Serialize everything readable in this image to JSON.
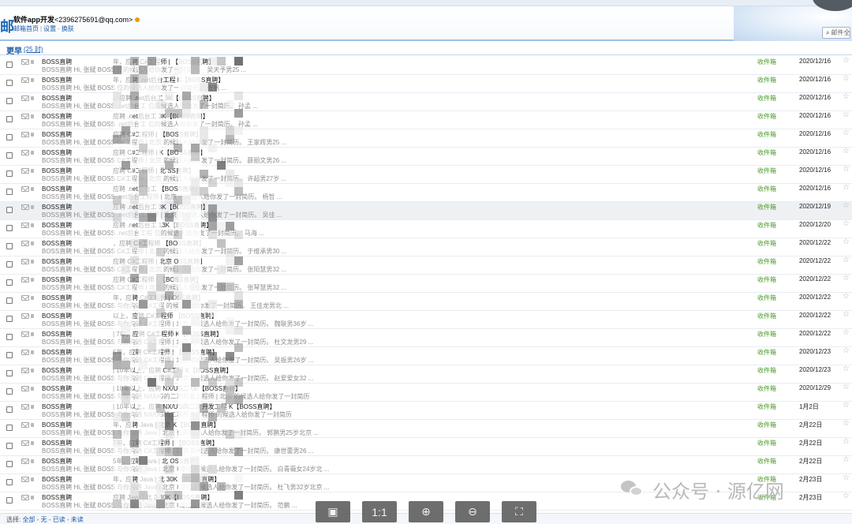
{
  "header": {
    "account_name": "软件app开发",
    "account_email": "<2396275691@qq.com>",
    "links": [
      "邮箱首页",
      "设置",
      "换肤"
    ],
    "search_placeholder": "邮件全"
  },
  "section": {
    "title": "更早",
    "count": "(25 封)"
  },
  "rows": [
    {
      "sender": "BOSS直聘",
      "subject": "年，应聘 C#工程师 | 【BOSS直聘】",
      "preview": "BOSS直聘 Hi, 张斌 BOSS 位的候选人给你发了一封简历。 吴天予男25 ...",
      "folder": "收件箱",
      "date": "2020/12/16"
    },
    {
      "sender": "BOSS直聘",
      "subject": "年，应聘 .net后台工程 K【BOSS直聘】",
      "preview": "BOSS直聘 Hi, 张斌 BOSS 位的候选人给你发了一封简历。 张帆 ...",
      "folder": "收件箱",
      "date": "2020/12/16"
    },
    {
      "sender": "BOSS直聘",
      "subject": "，应聘 .net后台工 3K【BOSS直聘】",
      "preview": "BOSS直聘 Hi, 张斌 BOSS .net后台工 位的候选人给你发了一封简历。 孙孟 ...",
      "folder": "收件箱",
      "date": "2020/12/16"
    },
    {
      "sender": "BOSS直聘",
      "subject": "应聘 .net后台工 3K【BOSS直聘】",
      "preview": "BOSS直聘 Hi, 张斌 BOSS .net后台工 位的候选人给你发了一封简历。 孙孟 ...",
      "folder": "收件箱",
      "date": "2020/12/16"
    },
    {
      "sender": "BOSS直聘",
      "subject": "应聘 C#工程师 | 【BOSS直聘】",
      "preview": "BOSS直聘 Hi, 张斌 BOSS C#工程师 | 北京 的候选人给你发了一封简历。 王家辉男25 ...",
      "folder": "收件箱",
      "date": "2020/12/16"
    },
    {
      "sender": "BOSS直聘",
      "subject": "应聘 C#工程师 | K【BOSS直聘】",
      "preview": "BOSS直聘 Hi, 张斌 BOSS C#工程师 | 北京 的候选人给你发了一封简历。 薛丽文男26 ...",
      "folder": "收件箱",
      "date": "2020/12/16"
    },
    {
      "sender": "BOSS直聘",
      "subject": "应聘 C#工程师 | 北 SS直聘】",
      "preview": "BOSS直聘 Hi, 张斌 BOSS C#工程师 | 北京 的候选人给你发了一封简历。 许超男27岁 ...",
      "folder": "收件箱",
      "date": "2020/12/16"
    },
    {
      "sender": "BOSS直聘",
      "subject": "应聘 .net后台工 【BOSS直聘】",
      "preview": "BOSS直聘 Hi, 张斌 BOSS .net后台工程师 | 北京 的候选人给你发了一封简历。 杨哲 ...",
      "folder": "收件箱",
      "date": "2020/12/16"
    },
    {
      "sender": "BOSS直聘",
      "subject": "应聘 .net后台工 3K【BOSS直聘】",
      "preview": "BOSS直聘 Hi, 张斌 BOSS .net后台工程师 | 北京 的候选人给你发了一封简历。 吴佳 ...",
      "folder": "收件箱",
      "date": "2020/12/19"
    },
    {
      "sender": "BOSS直聘",
      "subject": "应聘 .net后台工 13K【BOSS直聘】",
      "preview": "BOSS直聘 Hi, 张斌 BOSS .net后台工程 位的候选人给你发了一封简历。 马海 ...",
      "folder": "收件箱",
      "date": "2020/12/20"
    },
    {
      "sender": "BOSS直聘",
      "subject": "，应聘 C#工程师 【BOSS直聘】",
      "preview": "BOSS直聘 Hi, 张斌 BOSS C#工程师 | 北京 的候选人给你发了一封简历。 于维承男30 ...",
      "folder": "收件箱",
      "date": "2020/12/22"
    },
    {
      "sender": "BOSS直聘",
      "subject": "应聘 C#工程师 | 北京 OSS直聘】",
      "preview": "BOSS直聘 Hi, 张斌 BOSS C#工程师 | 北京 的候选人给你发了一封简历。 张阳慧男32 ...",
      "folder": "收件箱",
      "date": "2020/12/22"
    },
    {
      "sender": "BOSS直聘",
      "subject": "应聘 C#工程师 | 【BOSS直聘】",
      "preview": "BOSS直聘 Hi, 张斌 BOSS C#工程师 | 北京 的候选人给你发了一封简历。 张琴慧男32 ...",
      "folder": "收件箱",
      "date": "2020/12/22"
    },
    {
      "sender": "BOSS直聘",
      "subject": "年，应聘 C#工程师 | OSS直聘】",
      "preview": "BOSS直聘 Hi, 张斌 BOSS 与你沟通 C#工程 的候选人给你发了一封简历。 王佳龙男北 ...",
      "folder": "收件箱",
      "date": "2020/12/22"
    },
    {
      "sender": "BOSS直聘",
      "subject": "以上，应聘 C#工程师 【BOSS直聘】",
      "preview": "BOSS直聘 Hi, 张斌 BOSS 与你沟通 C#工程师 | 北京 的候选人给你发了一封简历。 魏联男36岁 ...",
      "folder": "收件箱",
      "date": "2020/12/22"
    },
    {
      "sender": "BOSS直聘",
      "subject": "| 7年，应聘 C#工程师 K【BOSS直聘】",
      "preview": "BOSS直聘 Hi, 张斌 BOSS 与你沟通 C#工程师 | 北京 的候选人给你发了一封简历。 杜文龙男29 ...",
      "folder": "收件箱",
      "date": "2020/12/22"
    },
    {
      "sender": "BOSS直聘",
      "subject": "5年，应聘 C#工程师 | 【BOSS直聘】",
      "preview": "BOSS直聘 Hi, 张斌 BOSS 与你沟通 C#工程师 | 北京 的候选人给你发了一封简历。 吴振男26岁 ...",
      "folder": "收件箱",
      "date": "2020/12/23"
    },
    {
      "sender": "BOSS直聘",
      "subject": "| 10年以上，应聘 C#工程 K【BOSS直聘】",
      "preview": "BOSS直聘 Hi, 张斌 BOSS 与你沟通 C#工程师 | 北京 的候选人给你发了一封简历。 赵爱爱女32 ...",
      "folder": "收件箱",
      "date": "2020/12/23"
    },
    {
      "sender": "BOSS直聘",
      "subject": "| 10年以上，应聘 NX/UG二 0K【BOSS直聘】",
      "preview": "BOSS直聘 Hi, 张斌 BOSS 与你沟通 NX/UG的二次开发工程师 | 北京 的候选人给你发了一封简历",
      "folder": "收件箱",
      "date": "2020/12/29"
    },
    {
      "sender": "BOSS直聘",
      "subject": "| 10年以上，应聘 NX/UG的二次开发工程 K【BOSS直聘】",
      "preview": "BOSS直聘 Hi, 张斌 BOSS 与你沟通 NX/UG的二次开发工程师 的候选人给你发了一封简历",
      "folder": "收件箱",
      "date": "1月2日"
    },
    {
      "sender": "BOSS直聘",
      "subject": "年，应聘 Java | 北京 K【BOSS直聘】",
      "preview": "BOSS直聘 Hi, 张斌 BOSS 与你沟通 Java | 北京 位的候选人给你发了一封简历。 郭鹏男25岁北京 ...",
      "folder": "收件箱",
      "date": "2月22日"
    },
    {
      "sender": "BOSS直聘",
      "subject": "7年，应聘 C#工程师 | 【BOSS直聘】",
      "preview": "BOSS直聘 Hi, 张斌 BOSS 与你沟通 C#工程师 | 北京 的候选人给你发了一封简历。 康世蕾男26 ...",
      "folder": "收件箱",
      "date": "2月22日"
    },
    {
      "sender": "BOSS直聘",
      "subject": "5年，应聘 Java | 北 OSS直聘】",
      "preview": "BOSS直聘 Hi, 张斌 BOSS 与你沟通 Java | 北京 K职位的候选人给你发了一封简历。 白青薇女24岁北 ...",
      "folder": "收件箱",
      "date": "2月22日"
    },
    {
      "sender": "BOSS直聘",
      "subject": "年，应聘 Java | 北 30K【BOSS直聘】",
      "preview": "BOSS直聘 Hi, 张斌 BOSS 与你沟通 Java | 北京 K职位的候选人给你发了一封简历。 杜飞男32岁北京 ...",
      "folder": "收件箱",
      "date": "2月23日"
    },
    {
      "sender": "BOSS直聘",
      "subject": "应聘 Java | 北 2-30K【BOSS直聘】",
      "preview": "BOSS直聘 Hi, 张斌 BOSS 与你沟通 Java | 北京 K职位的候选人给你发了一封简历。 范鹏 ...",
      "folder": "收件箱",
      "date": "2月23日"
    }
  ],
  "footer": {
    "label": "选择:",
    "options": [
      "全部",
      "无",
      "已读",
      "未读"
    ]
  },
  "viewer_buttons": [
    "▣",
    "1:1",
    "⊕",
    "⊖",
    "⛶"
  ],
  "watermark": "公众号 · 源亿网",
  "colors": {
    "accent": "#1d5aa5",
    "folder_green": "#4c9a2a"
  }
}
